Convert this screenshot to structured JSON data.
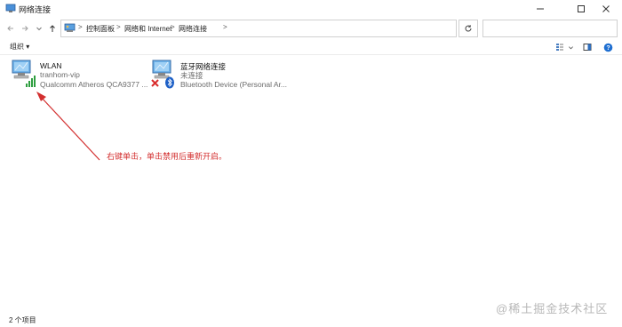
{
  "window": {
    "title": "网络连接",
    "minimize_icon": "minimize-icon",
    "maximize_icon": "maximize-icon",
    "close_icon": "close-icon"
  },
  "navigation": {
    "back_icon": "arrow-left-icon",
    "forward_icon": "arrow-right-icon",
    "recent_icon": "chevron-down-icon",
    "up_icon": "arrow-up-icon",
    "breadcrumbs": [
      "控制面板",
      "网络和 Internet",
      "网络连接"
    ],
    "separator": ">",
    "refresh_icon": "refresh-icon",
    "search_placeholder": ""
  },
  "toolbar": {
    "organize_label": "组织 ▾"
  },
  "connections": [
    {
      "name": "WLAN",
      "network": "tranhom-vip",
      "device": "Qualcomm Atheros QCA9377 ...",
      "icon": "wifi-adapter-icon",
      "status": "connected"
    },
    {
      "name": "蓝牙网络连接",
      "network": "未连接",
      "device": "Bluetooth Device (Personal Ar...",
      "icon": "bluetooth-adapter-icon",
      "status": "disconnected"
    }
  ],
  "annotation": {
    "text": "右键单击，单击禁用后重新开启。",
    "color": "#d32f2f"
  },
  "statusbar": {
    "item_count": "2 个项目"
  },
  "watermark": "@稀土掘金技术社区"
}
